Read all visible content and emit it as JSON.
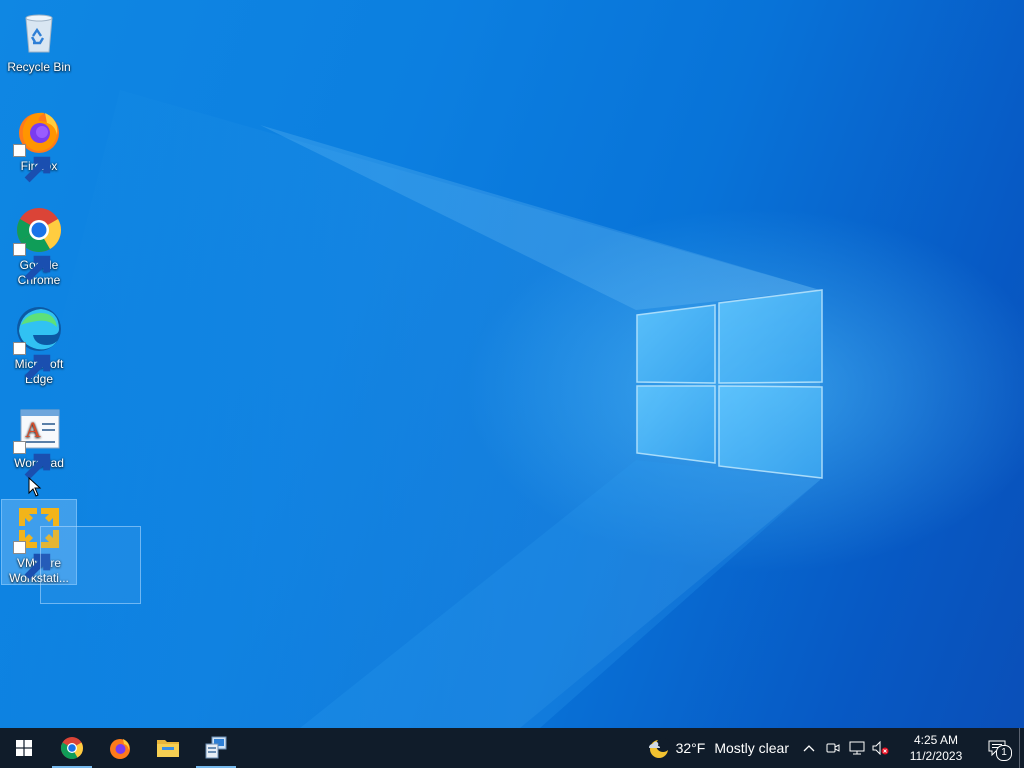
{
  "desktop": {
    "icons": [
      {
        "name": "recycle-bin",
        "label": "Recycle Bin",
        "icon": "recycle-bin-icon",
        "shortcut": false
      },
      {
        "name": "firefox",
        "label": "Firefox",
        "icon": "firefox-icon",
        "shortcut": true
      },
      {
        "name": "google-chrome",
        "label": "Google Chrome",
        "icon": "chrome-icon",
        "shortcut": true
      },
      {
        "name": "microsoft-edge",
        "label": "Microsoft Edge",
        "icon": "edge-icon",
        "shortcut": true
      },
      {
        "name": "wordpad",
        "label": "WordPad",
        "icon": "wordpad-icon",
        "shortcut": true
      },
      {
        "name": "vmware-workstation",
        "label": "VMware Workstati...",
        "icon": "vmware-icon",
        "shortcut": true,
        "selected": true
      }
    ]
  },
  "taskbar": {
    "pinned": [
      {
        "name": "start",
        "icon": "windows-start-icon"
      },
      {
        "name": "chrome",
        "icon": "chrome-icon",
        "active": true
      },
      {
        "name": "firefox",
        "icon": "firefox-icon"
      },
      {
        "name": "file-explorer",
        "icon": "file-explorer-icon"
      },
      {
        "name": "app",
        "icon": "app-icon",
        "active": true
      }
    ],
    "weather": {
      "icon": "moon-cloud-icon",
      "temp": "32°F",
      "condition": "Mostly clear"
    },
    "tray": [
      "chevron-up-icon",
      "meet-now-icon",
      "network-icon",
      "volume-muted-icon"
    ],
    "clock": {
      "time": "4:25 AM",
      "date": "11/2/2023"
    },
    "notifications": {
      "icon": "action-center-icon",
      "count": "1"
    }
  },
  "colors": {
    "taskbar": "#101c2a",
    "accent": "#76b9ed",
    "wallpaper": "#0a73dc"
  }
}
